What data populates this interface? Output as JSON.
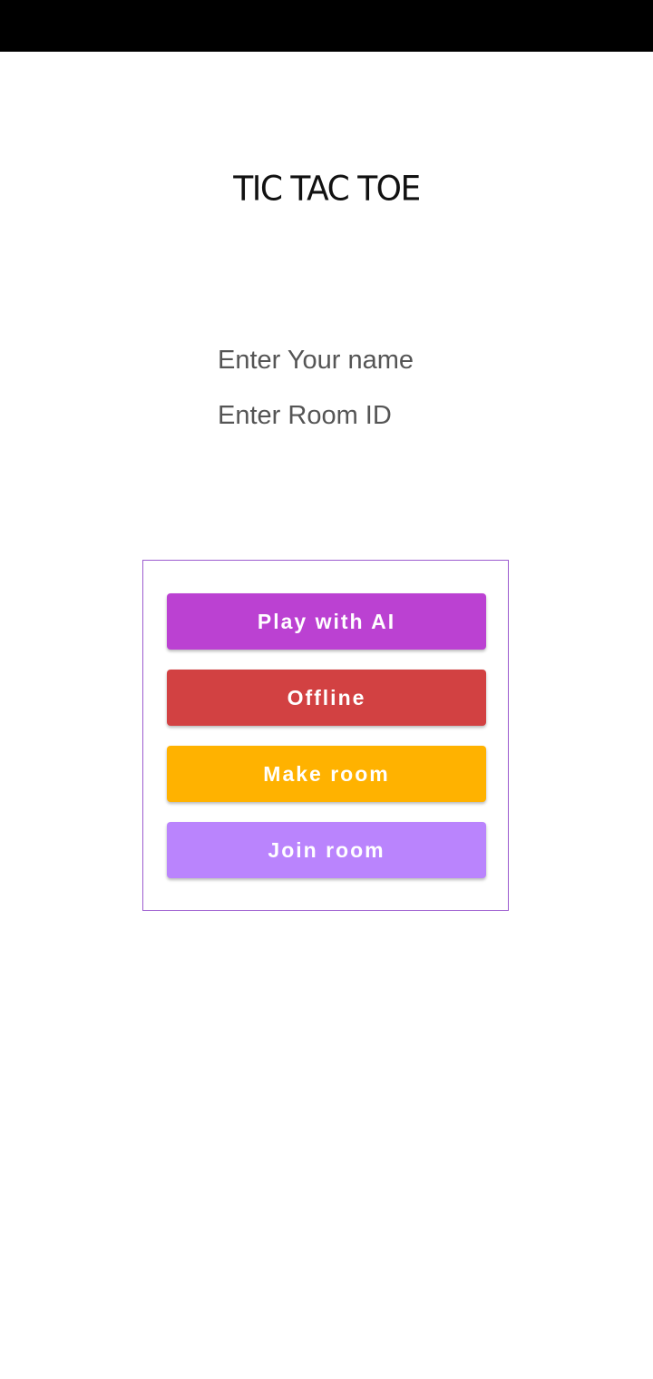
{
  "app": {
    "title": "TIC TAC TOE"
  },
  "form": {
    "name_placeholder": "Enter Your name",
    "room_placeholder": "Enter Room ID",
    "name_value": "",
    "room_value": ""
  },
  "buttons": {
    "play_ai": {
      "label": "Play with AI",
      "color": "#bb41d2"
    },
    "offline": {
      "label": "Offline",
      "color": "#d24142"
    },
    "make_room": {
      "label": "Make room",
      "color": "#ffb200"
    },
    "join_room": {
      "label": "Join room",
      "color": "#ba84fd"
    }
  },
  "colors": {
    "panel_border": "#9c5ccf",
    "status_bar": "#000000"
  }
}
